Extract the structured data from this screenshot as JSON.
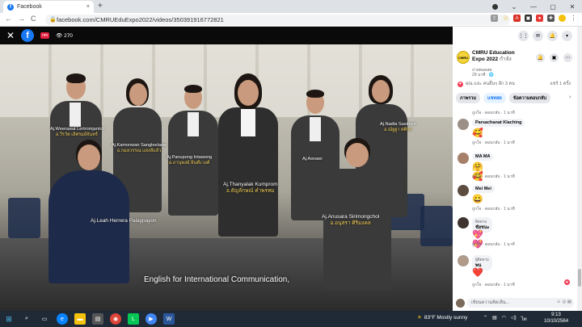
{
  "browser": {
    "tab_title": "Facebook",
    "tab_favicon": "f",
    "tab_close": "×",
    "new_tab": "+",
    "url": "facebook.com/CMRUEduExpo2022/videos/350391916772821",
    "nav": {
      "back": "←",
      "forward": "→",
      "reload": "C"
    }
  },
  "video": {
    "views": "270",
    "live_badge": "nm",
    "caption": "English for International Communication,",
    "people": [
      {
        "en": "Aj.Weerawat Lertromjantol",
        "th": "อ.วีรวัต เลิศรมย์จันทร์"
      },
      {
        "en": "Aj.Kamonwan Sangleelaew",
        "th": "อ.กมลวรรณ แสงลีแล้ว"
      },
      {
        "en": "Aj.Panupong Intawong",
        "th": "อ.ภานุพงษ์ อินต๊ะวงค์"
      },
      {
        "en": "Aj.Thanyalak Kumprom",
        "th": "อ.ธัญลักษณ์ คำพรหม"
      },
      {
        "en": "Aj.Asnawi",
        "th": ""
      },
      {
        "en": "Aj.Nadta Sasithon",
        "th": "อ.ณัฐฐา ศศิธร"
      },
      {
        "en": "Aj.Leah Herrera Palaypayon",
        "th": ""
      },
      {
        "en": "Aj.Anusara Sirimongchol",
        "th": "อ.อนุสรา ศิริมงคล"
      }
    ]
  },
  "panel": {
    "page_name": "CMRU Education Expo 2022",
    "page_name_suffix": "กำลัง",
    "page_status": "ถ่ายทอดสด",
    "page_time": "29 นาที · ",
    "reactions": "คุณ และ คนอื่นๆ อีก 3 คน",
    "shares": "แชร์ 1 ครั้ง",
    "tabs": [
      "ภาพรวม",
      "แชทสด",
      "ข้อความตอบกลับ"
    ],
    "comments": [
      {
        "name": "",
        "text": "",
        "emoji": "",
        "meta": "ถูกใจ · ตอบกลับ · 1 นาที"
      },
      {
        "name": "Parsachanat Klaching",
        "badge": "",
        "text": "",
        "emoji": "🥰",
        "meta": "ถูกใจ · ตอบกลับ · 1 นาที"
      },
      {
        "name": "MA MA",
        "badge": "",
        "text": "",
        "emoji": "🤗🥰",
        "meta": "ถูกใจ · ตอบกลับ · 1 นาที"
      },
      {
        "name": "Mei Mei",
        "badge": "",
        "text": "",
        "emoji": "😀",
        "meta": "ถูกใจ · ตอบกลับ · 1 นาที"
      },
      {
        "name": "ชัยชนะ",
        "badge": "ติดตาม",
        "text": "",
        "emoji": "💖💖",
        "meta": "ถูกใจ · ตอบกลับ · 1 นาที"
      },
      {
        "name": "พน",
        "badge": "ผู้ติดตาม",
        "text": "",
        "emoji": "❤️",
        "meta": "ถูกใจ · ตอบกลับ · 1 นาที"
      }
    ],
    "composer_placeholder": "เขียนความคิดเห็น...",
    "composer_icons": "☺ ◎ ▤"
  },
  "taskbar": {
    "weather": "83°F  Mostly sunny",
    "time": "9:13",
    "date": "10/10/2564"
  },
  "colors": {
    "facebook_blue": "#1877f2",
    "heart_red": "#f33e58",
    "taskbar": "#1f2a36"
  }
}
